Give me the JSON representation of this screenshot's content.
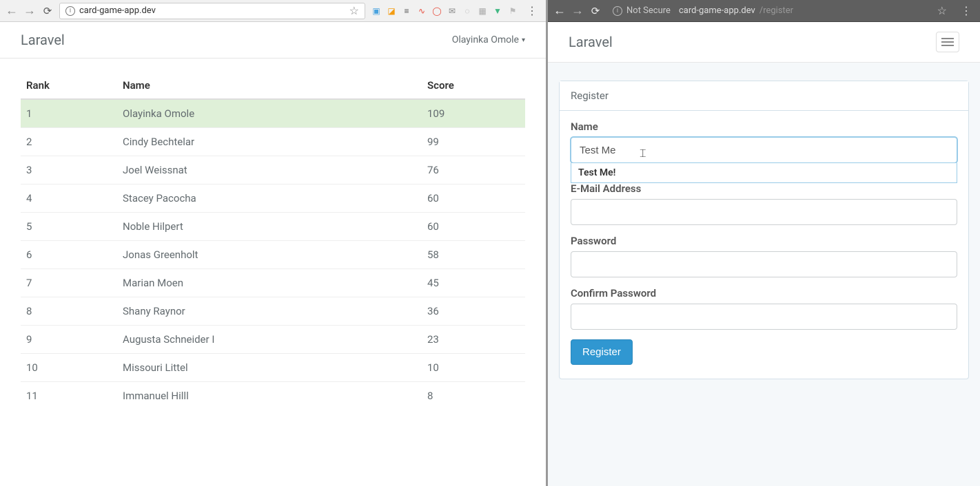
{
  "left": {
    "browser": {
      "url": "card-game-app.dev"
    },
    "navbar": {
      "brand": "Laravel",
      "user": "Olayinka Omole"
    },
    "table": {
      "headers": {
        "rank": "Rank",
        "name": "Name",
        "score": "Score"
      },
      "rows": [
        {
          "rank": "1",
          "name": "Olayinka Omole",
          "score": "109",
          "highlight": true
        },
        {
          "rank": "2",
          "name": "Cindy Bechtelar",
          "score": "99"
        },
        {
          "rank": "3",
          "name": "Joel Weissnat",
          "score": "76"
        },
        {
          "rank": "4",
          "name": "Stacey Pacocha",
          "score": "60"
        },
        {
          "rank": "5",
          "name": "Noble Hilpert",
          "score": "60"
        },
        {
          "rank": "6",
          "name": "Jonas Greenholt",
          "score": "58"
        },
        {
          "rank": "7",
          "name": "Marian Moen",
          "score": "45"
        },
        {
          "rank": "8",
          "name": "Shany Raynor",
          "score": "36"
        },
        {
          "rank": "9",
          "name": "Augusta Schneider I",
          "score": "23"
        },
        {
          "rank": "10",
          "name": "Missouri Littel",
          "score": "10"
        },
        {
          "rank": "11",
          "name": "Immanuel Hilll",
          "score": "8"
        }
      ]
    }
  },
  "right": {
    "browser": {
      "not_secure": "Not Secure",
      "url_host": "card-game-app.dev",
      "url_path": "/register"
    },
    "navbar": {
      "brand": "Laravel"
    },
    "panel": {
      "title": "Register"
    },
    "form": {
      "name_label": "Name",
      "name_value": "Test Me",
      "autocomplete": "Test Me!",
      "email_label": "E-Mail Address",
      "password_label": "Password",
      "confirm_label": "Confirm Password",
      "submit_label": "Register"
    }
  }
}
